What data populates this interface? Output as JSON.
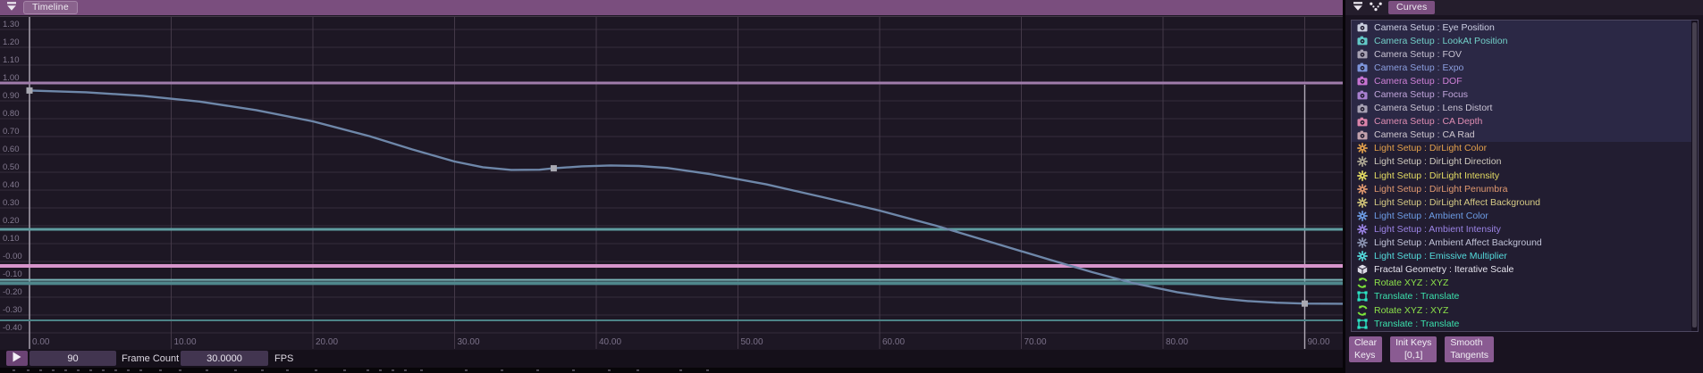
{
  "timeline": {
    "tab": "Timeline",
    "frame_count": "90",
    "frame_count_label": "Frame Count",
    "fps": "30.0000",
    "fps_label": "FPS"
  },
  "curves_panel": {
    "tab": "Curves",
    "items": [
      {
        "label": "Camera Setup : Eye Position",
        "icon": "camera-icon",
        "color": "#cdd0e4",
        "icon_color": "#c9cede",
        "selected": true
      },
      {
        "label": "Camera Setup : LookAt Position",
        "icon": "camera-icon",
        "color": "#72cfc8",
        "icon_color": "#62c9c7",
        "selected": true
      },
      {
        "label": "Camera Setup : FOV",
        "icon": "camera-icon",
        "color": "#c6c1d1",
        "icon_color": "#a8a2b4",
        "selected": true
      },
      {
        "label": "Camera Setup : Expo",
        "icon": "camera-icon",
        "color": "#8b9ede",
        "icon_color": "#7e95dc",
        "selected": true
      },
      {
        "label": "Camera Setup : DOF",
        "icon": "camera-icon",
        "color": "#cf80d6",
        "icon_color": "#c873d2",
        "selected": true
      },
      {
        "label": "Camera Setup : Focus",
        "icon": "camera-icon",
        "color": "#c0a5da",
        "icon_color": "#a980d0",
        "selected": true
      },
      {
        "label": "Camera Setup : Lens Distort",
        "icon": "camera-icon",
        "color": "#c9c3d3",
        "icon_color": "#a8a2b4",
        "selected": true
      },
      {
        "label": "Camera Setup : CA Depth",
        "icon": "camera-icon",
        "color": "#df8db3",
        "icon_color": "#dc84ab",
        "selected": true
      },
      {
        "label": "Camera Setup : CA Rad",
        "icon": "camera-icon",
        "color": "#cfc7ce",
        "icon_color": "#c3a2ad",
        "selected": true
      },
      {
        "label": "Light Setup : DirLight Color",
        "icon": "sun-icon",
        "color": "#e3a04b",
        "icon_color": "#e3a04b",
        "selected": false
      },
      {
        "label": "Light Setup : DirLight Direction",
        "icon": "sun-icon",
        "color": "#cec9bd",
        "icon_color": "#b1aa95",
        "selected": false
      },
      {
        "label": "Light Setup : DirLight Intensity",
        "icon": "sun-icon",
        "color": "#e4dc63",
        "icon_color": "#e4dc63",
        "selected": false
      },
      {
        "label": "Light Setup : DirLight Penumbra",
        "icon": "sun-icon",
        "color": "#e29a70",
        "icon_color": "#e29a70",
        "selected": false
      },
      {
        "label": "Light Setup : DirLight Affect Background",
        "icon": "sun-icon",
        "color": "#d6cb85",
        "icon_color": "#d0c378",
        "selected": false
      },
      {
        "label": "Light Setup : Ambient Color",
        "icon": "sun-icon",
        "color": "#6d9de6",
        "icon_color": "#6d9de6",
        "selected": false
      },
      {
        "label": "Light Setup : Ambient Intensity",
        "icon": "sun-icon",
        "color": "#9c84e6",
        "icon_color": "#9c84e6",
        "selected": false
      },
      {
        "label": "Light Setup : Ambient Affect Background",
        "icon": "sun-icon",
        "color": "#c1c3d7",
        "icon_color": "#8c94b2",
        "selected": false
      },
      {
        "label": "Light Setup : Emissive Multiplier",
        "icon": "sun-icon",
        "color": "#54dcdd",
        "icon_color": "#54dcdd",
        "selected": false
      },
      {
        "label": "Fractal Geometry : Iterative Scale",
        "icon": "cube-icon",
        "color": "#e6e4ee",
        "icon_color": "#dcdae6",
        "selected": false
      },
      {
        "label": "Rotate XYZ : XYZ",
        "icon": "rotate-icon",
        "color": "#8ce24a",
        "icon_color": "#7de63a",
        "selected": false
      },
      {
        "label": "Translate : Translate",
        "icon": "translate-icon",
        "color": "#3be2ad",
        "icon_color": "#2ce4c4",
        "selected": false
      },
      {
        "label": "Rotate XYZ : XYZ",
        "icon": "rotate-icon",
        "color": "#8ce24a",
        "icon_color": "#7de63a",
        "selected": false
      },
      {
        "label": "Translate : Translate",
        "icon": "translate-icon",
        "color": "#3be2ad",
        "icon_color": "#2ce4c4",
        "selected": false
      }
    ],
    "buttons": [
      {
        "line1": "Clear",
        "line2": "Keys"
      },
      {
        "line1": "Init Keys",
        "line2": "[0,1]"
      },
      {
        "line1": "Smooth",
        "line2": "Tangents"
      }
    ]
  },
  "chart_data": {
    "type": "line",
    "x_ticks": [
      "0.00",
      "10.00",
      "20.00",
      "30.00",
      "40.00",
      "50.00",
      "60.00",
      "70.00",
      "80.00",
      "90.00"
    ],
    "y_ticks": [
      "1.30",
      "1.20",
      "1.10",
      "1.00",
      "0.90",
      "0.80",
      "0.70",
      "0.60",
      "0.50",
      "0.40",
      "0.30",
      "0.20",
      "0.10",
      "-0.00",
      "-0.10",
      "-0.20",
      "-0.30",
      "-0.40"
    ],
    "xlim": [
      0,
      92.7
    ],
    "ylim": [
      -0.5,
      1.38
    ],
    "grid": true,
    "playheads": [
      0,
      90
    ],
    "flat_lines": [
      {
        "value": 1.0,
        "color": "#a07cab",
        "width": 3
      },
      {
        "value": 0.18,
        "color": "#5f9da1",
        "width": 3
      },
      {
        "value": -0.025,
        "color": "#d795cb",
        "width": 4
      },
      {
        "value": -0.103,
        "color": "#7ab4b8",
        "width": 2
      },
      {
        "value": -0.122,
        "color": "#4f878c",
        "width": 4
      },
      {
        "value": -0.33,
        "color": "#4d8387",
        "width": 2
      }
    ],
    "main_curve": {
      "color": "#6e87a9",
      "width": 2.4,
      "points": [
        [
          0,
          0.958
        ],
        [
          4,
          0.948
        ],
        [
          8,
          0.928
        ],
        [
          12,
          0.896
        ],
        [
          16,
          0.848
        ],
        [
          20,
          0.785
        ],
        [
          24,
          0.702
        ],
        [
          27,
          0.628
        ],
        [
          30,
          0.56
        ],
        [
          32,
          0.528
        ],
        [
          34,
          0.513
        ],
        [
          36,
          0.514
        ],
        [
          37,
          0.522
        ],
        [
          39,
          0.533
        ],
        [
          41,
          0.538
        ],
        [
          43,
          0.535
        ],
        [
          45,
          0.524
        ],
        [
          48,
          0.49
        ],
        [
          52,
          0.432
        ],
        [
          56,
          0.36
        ],
        [
          60,
          0.285
        ],
        [
          64,
          0.2
        ],
        [
          68,
          0.105
        ],
        [
          72,
          0.01
        ],
        [
          75,
          -0.06
        ],
        [
          78,
          -0.123
        ],
        [
          81,
          -0.172
        ],
        [
          84,
          -0.207
        ],
        [
          86,
          -0.222
        ],
        [
          88,
          -0.231
        ],
        [
          90,
          -0.236
        ],
        [
          92.8,
          -0.237
        ]
      ],
      "keyframes": [
        [
          0,
          0.958
        ],
        [
          37,
          0.522
        ],
        [
          90,
          -0.236
        ]
      ],
      "keyframe_color": "#a9a9b2"
    }
  }
}
